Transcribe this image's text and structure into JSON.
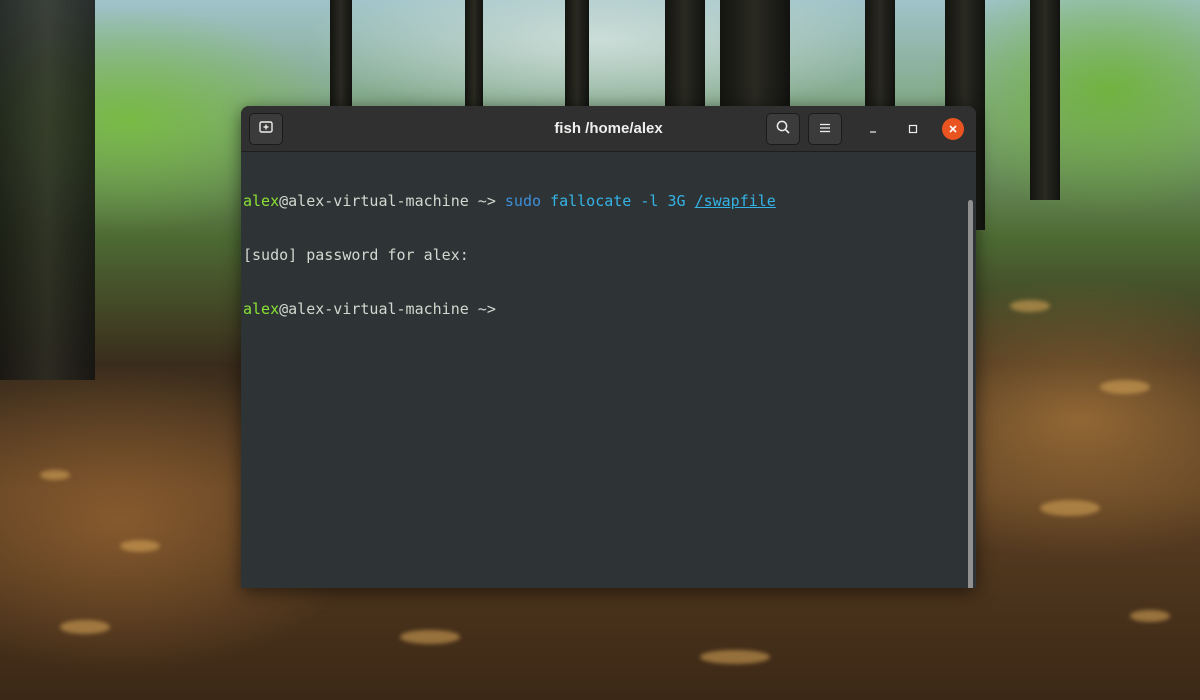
{
  "window": {
    "title": "fish /home/alex"
  },
  "header": {
    "new_tab_icon": "new-tab-icon",
    "search_icon": "search-icon",
    "menu_icon": "hamburger-menu-icon",
    "minimize_icon": "minimize-icon",
    "maximize_icon": "maximize-icon",
    "close_icon": "close-icon"
  },
  "terminal": {
    "lines": [
      {
        "user": "alex",
        "host": "@alex-virtual-machine",
        "cwd": " ~",
        "prompt_symbol": ">",
        "cmd": "sudo",
        "args": "fallocate -l 3G",
        "path": "/swapfile"
      },
      {
        "text": "[sudo] password for alex:"
      },
      {
        "user": "alex",
        "host": "@alex-virtual-machine",
        "cwd": " ~",
        "prompt_symbol": ">"
      }
    ]
  },
  "colors": {
    "prompt_user": "#8ae234",
    "command": "#3d8fd9",
    "argument": "#35b3e6",
    "close_button": "#e95420",
    "background": "#2e3436"
  }
}
